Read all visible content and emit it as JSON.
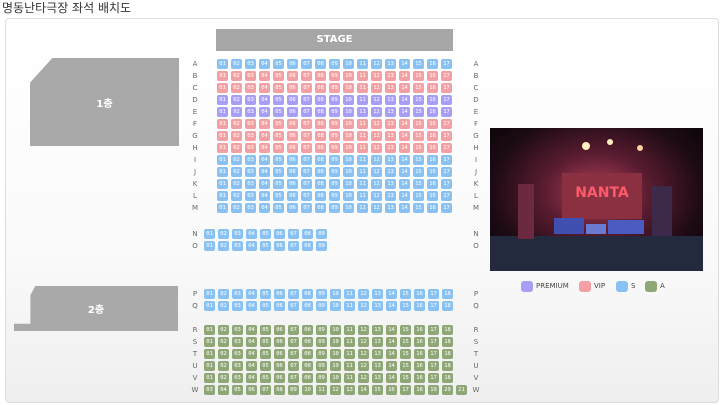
{
  "title": "명동난타극장 좌석 배치도",
  "stage_label": "STAGE",
  "floors": [
    {
      "label": "1층"
    },
    {
      "label": "2층"
    }
  ],
  "colors": {
    "premium": "#a79ff5",
    "vip": "#f2a0a4",
    "s": "#89c2f2",
    "a": "#8fa676"
  },
  "legend": [
    {
      "label": "PREMIUM",
      "color": "#a79ff5"
    },
    {
      "label": "VIP",
      "color": "#f2a0a4"
    },
    {
      "label": "S",
      "color": "#89c2f2"
    },
    {
      "label": "A",
      "color": "#8fa676"
    }
  ],
  "rows": [
    {
      "label": "A",
      "seats": [
        "01",
        "02",
        "03",
        "04",
        "05",
        "06",
        "07",
        "08",
        "09",
        "10",
        "11",
        "12",
        "13",
        "14",
        "15",
        "16",
        "17"
      ],
      "tier": "s"
    },
    {
      "label": "B",
      "seats": [
        "01",
        "02",
        "03",
        "04",
        "05",
        "06",
        "07",
        "08",
        "09",
        "10",
        "11",
        "12",
        "13",
        "14",
        "15",
        "16",
        "17"
      ],
      "tier": "vip"
    },
    {
      "label": "C",
      "seats": [
        "01",
        "02",
        "03",
        "04",
        "05",
        "06",
        "07",
        "08",
        "09",
        "10",
        "11",
        "12",
        "13",
        "14",
        "15",
        "16",
        "17"
      ],
      "tier": "vip"
    },
    {
      "label": "D",
      "seats": [
        "01",
        "02",
        "03",
        "04",
        "05",
        "06",
        "07",
        "08",
        "09",
        "10",
        "11",
        "12",
        "13",
        "14",
        "15",
        "16",
        "17"
      ],
      "tier": "premium"
    },
    {
      "label": "E",
      "seats": [
        "01",
        "02",
        "03",
        "04",
        "05",
        "06",
        "07",
        "08",
        "09",
        "10",
        "11",
        "12",
        "13",
        "14",
        "15",
        "16",
        "17"
      ],
      "tier": "premium"
    },
    {
      "label": "F",
      "seats": [
        "01",
        "02",
        "03",
        "04",
        "05",
        "06",
        "07",
        "08",
        "09",
        "10",
        "11",
        "12",
        "13",
        "14",
        "15",
        "16",
        "17"
      ],
      "tier": "vip"
    },
    {
      "label": "G",
      "seats": [
        "01",
        "02",
        "03",
        "04",
        "05",
        "06",
        "07",
        "08",
        "09",
        "10",
        "11",
        "12",
        "13",
        "14",
        "15",
        "16",
        "17"
      ],
      "tier": "vip"
    },
    {
      "label": "H",
      "seats": [
        "01",
        "02",
        "03",
        "04",
        "05",
        "06",
        "07",
        "08",
        "09",
        "10",
        "11",
        "12",
        "13",
        "14",
        "15",
        "16",
        "17"
      ],
      "tier": "vip"
    },
    {
      "label": "I",
      "seats": [
        "01",
        "02",
        "03",
        "04",
        "05",
        "06",
        "07",
        "08",
        "09",
        "10",
        "11",
        "12",
        "13",
        "14",
        "15",
        "16",
        "17"
      ],
      "tier": "s"
    },
    {
      "label": "J",
      "seats": [
        "01",
        "02",
        "03",
        "04",
        "05",
        "06",
        "07",
        "08",
        "09",
        "10",
        "11",
        "12",
        "13",
        "14",
        "15",
        "16",
        "17"
      ],
      "tier": "s"
    },
    {
      "label": "K",
      "seats": [
        "01",
        "02",
        "03",
        "04",
        "05",
        "06",
        "07",
        "08",
        "09",
        "10",
        "11",
        "12",
        "13",
        "14",
        "15",
        "16",
        "17"
      ],
      "tier": "s"
    },
    {
      "label": "L",
      "seats": [
        "01",
        "02",
        "03",
        "04",
        "05",
        "06",
        "07",
        "08",
        "09",
        "10",
        "11",
        "12",
        "13",
        "14",
        "15",
        "16",
        "17"
      ],
      "tier": "s"
    },
    {
      "label": "M",
      "seats": [
        "01",
        "02",
        "03",
        "04",
        "05",
        "06",
        "07",
        "08",
        "09",
        "10",
        "11",
        "12",
        "13",
        "14",
        "15",
        "16",
        "17"
      ],
      "tier": "s"
    },
    {
      "label": "N",
      "seats": [
        "01",
        "02",
        "03",
        "04",
        "05",
        "06",
        "07",
        "08",
        "09"
      ],
      "tier": "s"
    },
    {
      "label": "O",
      "seats": [
        "01",
        "02",
        "03",
        "04",
        "05",
        "06",
        "07",
        "08",
        "09"
      ],
      "tier": "s"
    },
    {
      "label": "P",
      "seats": [
        "01",
        "02",
        "03",
        "04",
        "05",
        "06",
        "07",
        "08",
        "09",
        "10",
        "11",
        "12",
        "13",
        "14",
        "15",
        "16",
        "17",
        "18"
      ],
      "tier": "s"
    },
    {
      "label": "Q",
      "seats": [
        "01",
        "02",
        "03",
        "04",
        "05",
        "06",
        "07",
        "08",
        "09",
        "10",
        "11",
        "12",
        "13",
        "14",
        "15",
        "16",
        "17",
        "18"
      ],
      "tier": "s"
    },
    {
      "label": "R",
      "seats": [
        "01",
        "02",
        "03",
        "04",
        "05",
        "06",
        "07",
        "08",
        "09",
        "10",
        "11",
        "12",
        "13",
        "14",
        "15",
        "16",
        "17",
        "18"
      ],
      "tier": "a"
    },
    {
      "label": "S",
      "seats": [
        "01",
        "02",
        "03",
        "04",
        "05",
        "06",
        "07",
        "08",
        "09",
        "10",
        "11",
        "12",
        "13",
        "14",
        "15",
        "16",
        "17",
        "18"
      ],
      "tier": "a"
    },
    {
      "label": "T",
      "seats": [
        "01",
        "02",
        "03",
        "04",
        "05",
        "06",
        "07",
        "08",
        "09",
        "10",
        "11",
        "12",
        "13",
        "14",
        "15",
        "16",
        "17",
        "18"
      ],
      "tier": "a"
    },
    {
      "label": "U",
      "seats": [
        "01",
        "02",
        "03",
        "04",
        "05",
        "06",
        "07",
        "08",
        "09",
        "10",
        "11",
        "12",
        "13",
        "14",
        "15",
        "16",
        "17",
        "18"
      ],
      "tier": "a"
    },
    {
      "label": "V",
      "seats": [
        "01",
        "02",
        "03",
        "04",
        "05",
        "06",
        "07",
        "08",
        "09",
        "10",
        "11",
        "12",
        "13",
        "14",
        "15",
        "16",
        "17",
        "18"
      ],
      "tier": "a"
    },
    {
      "label": "W",
      "seats": [
        "03",
        "04",
        "05",
        "06",
        "07",
        "08",
        "09",
        "10",
        "11",
        "12",
        "13",
        "14",
        "15",
        "16",
        "17",
        "18",
        "19",
        "20",
        "21"
      ],
      "tier": "a"
    }
  ]
}
